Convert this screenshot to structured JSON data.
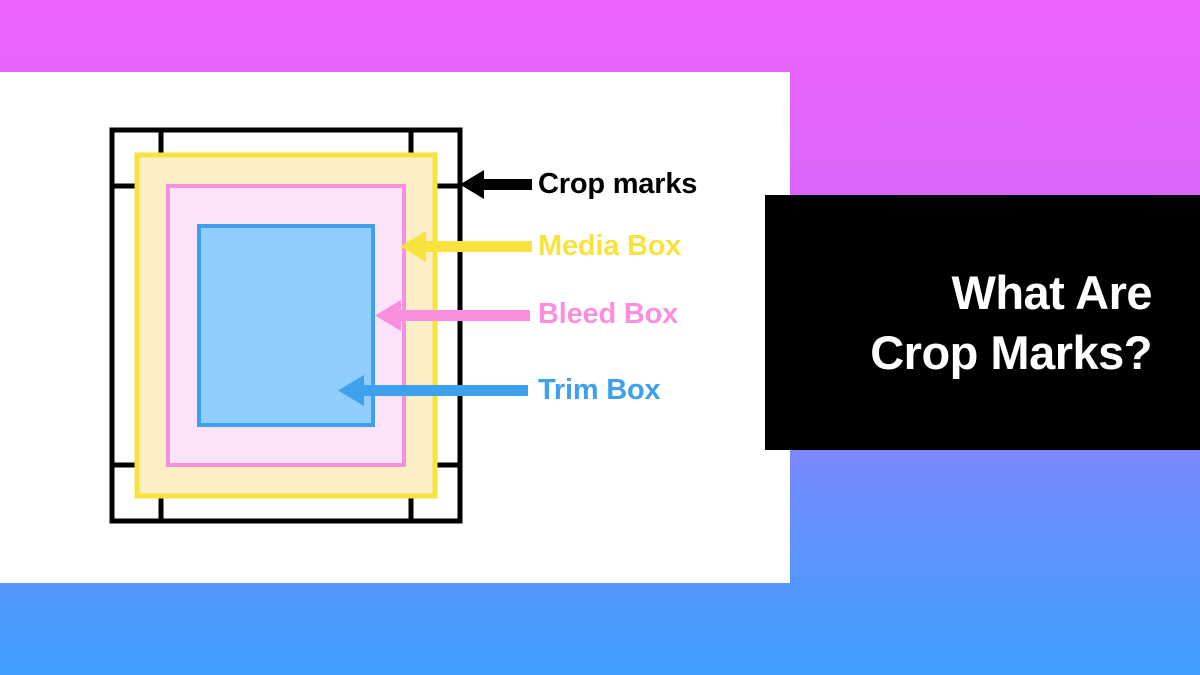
{
  "background": {
    "gradient_start": "#ee63fb",
    "gradient_end": "#3fa0fe"
  },
  "panel": {
    "background": "#ffffff"
  },
  "title_block": {
    "background": "#000000",
    "text_color": "#ffffff",
    "title": "What Are\nCrop Marks?"
  },
  "diagram": {
    "name": "pdf-page-boxes-diagram",
    "crop_marks": {
      "label": "Crop marks",
      "color": "#000000",
      "arrow_color": "#000000"
    },
    "media_box": {
      "label": "Media Box",
      "stroke": "#f7e23e",
      "fill": "#fdefc5",
      "arrow_color": "#f7e23e"
    },
    "bleed_box": {
      "label": "Bleed Box",
      "stroke": "#f58fe0",
      "fill": "#fce3fa",
      "arrow_color": "#fa8fe0"
    },
    "trim_box": {
      "label": "Trim Box",
      "stroke": "#3fa0ee",
      "fill": "#8fcdfa",
      "arrow_color": "#3fa0ee"
    }
  },
  "legend": [
    {
      "label": "Crop marks",
      "color": "#000000"
    },
    {
      "label": "Media Box",
      "color": "#f7e23e"
    },
    {
      "label": "Bleed Box",
      "color": "#fa8fe0"
    },
    {
      "label": "Trim Box",
      "color": "#3fa0ee"
    }
  ]
}
